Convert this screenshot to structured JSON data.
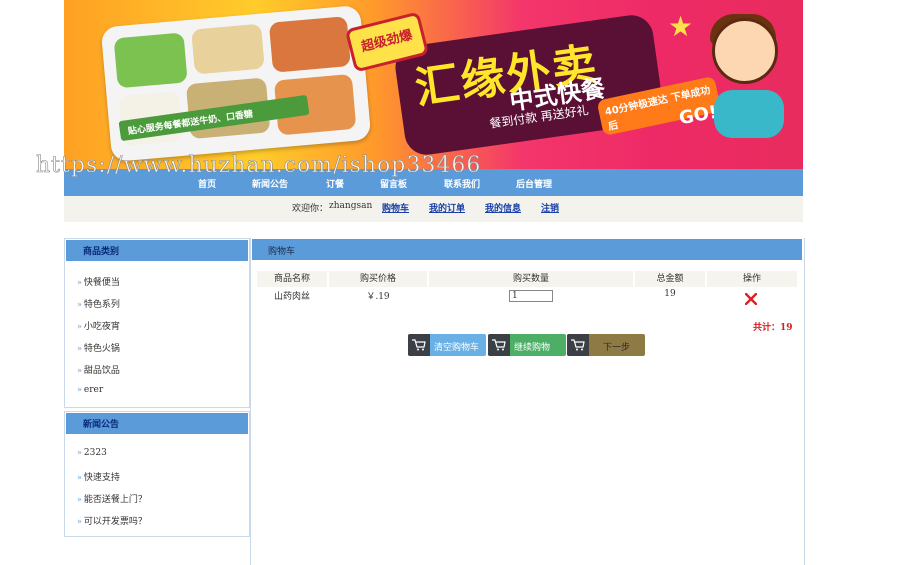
{
  "banner": {
    "badge": "超级劲爆",
    "headline": "汇缘外卖",
    "subheadline": "中式快餐",
    "slogan": "餐到付款 再送好礼",
    "promo": "40分钟极速达 下单成功后",
    "go": "GO!",
    "ribbon": "贴心服务每餐都送牛奶、口香糖",
    "watermark": "https://www.huzhan.com/ishop33466"
  },
  "nav": {
    "items": [
      "首页",
      "新闻公告",
      "订餐",
      "留言板",
      "联系我们",
      "后台管理"
    ]
  },
  "welcome": {
    "greeting": "欢迎你：",
    "username": "zhangsan",
    "links": [
      "购物车",
      "我的订单",
      "我的信息",
      "注销"
    ]
  },
  "sidebar": {
    "categories_title": "商品类别",
    "categories": [
      "快餐便当",
      "特色系列",
      "小吃夜宵",
      "特色火锅",
      "甜品饮品",
      "erer"
    ],
    "news_title": "新闻公告",
    "news": [
      "2323",
      "快速支持",
      "能否送餐上门？",
      "可以开发票吗？"
    ]
  },
  "cart": {
    "title": "购物车",
    "columns": [
      "商品名称",
      "购买价格",
      "购买数量",
      "总金额",
      "操作"
    ],
    "rows": [
      {
        "name": "山药肉丝",
        "price": "￥.19",
        "quantity": "1",
        "total": "19"
      }
    ],
    "total_label": "共计：19",
    "buttons": [
      "清空购物车",
      "继续购物",
      "下一步"
    ]
  },
  "colors": {
    "nav_blue": "#5b9bd9",
    "clear_button": "#6ab0e4",
    "continue_button": "#4caf65",
    "next_button": "#8e7a45",
    "delete_red": "#e02020"
  }
}
